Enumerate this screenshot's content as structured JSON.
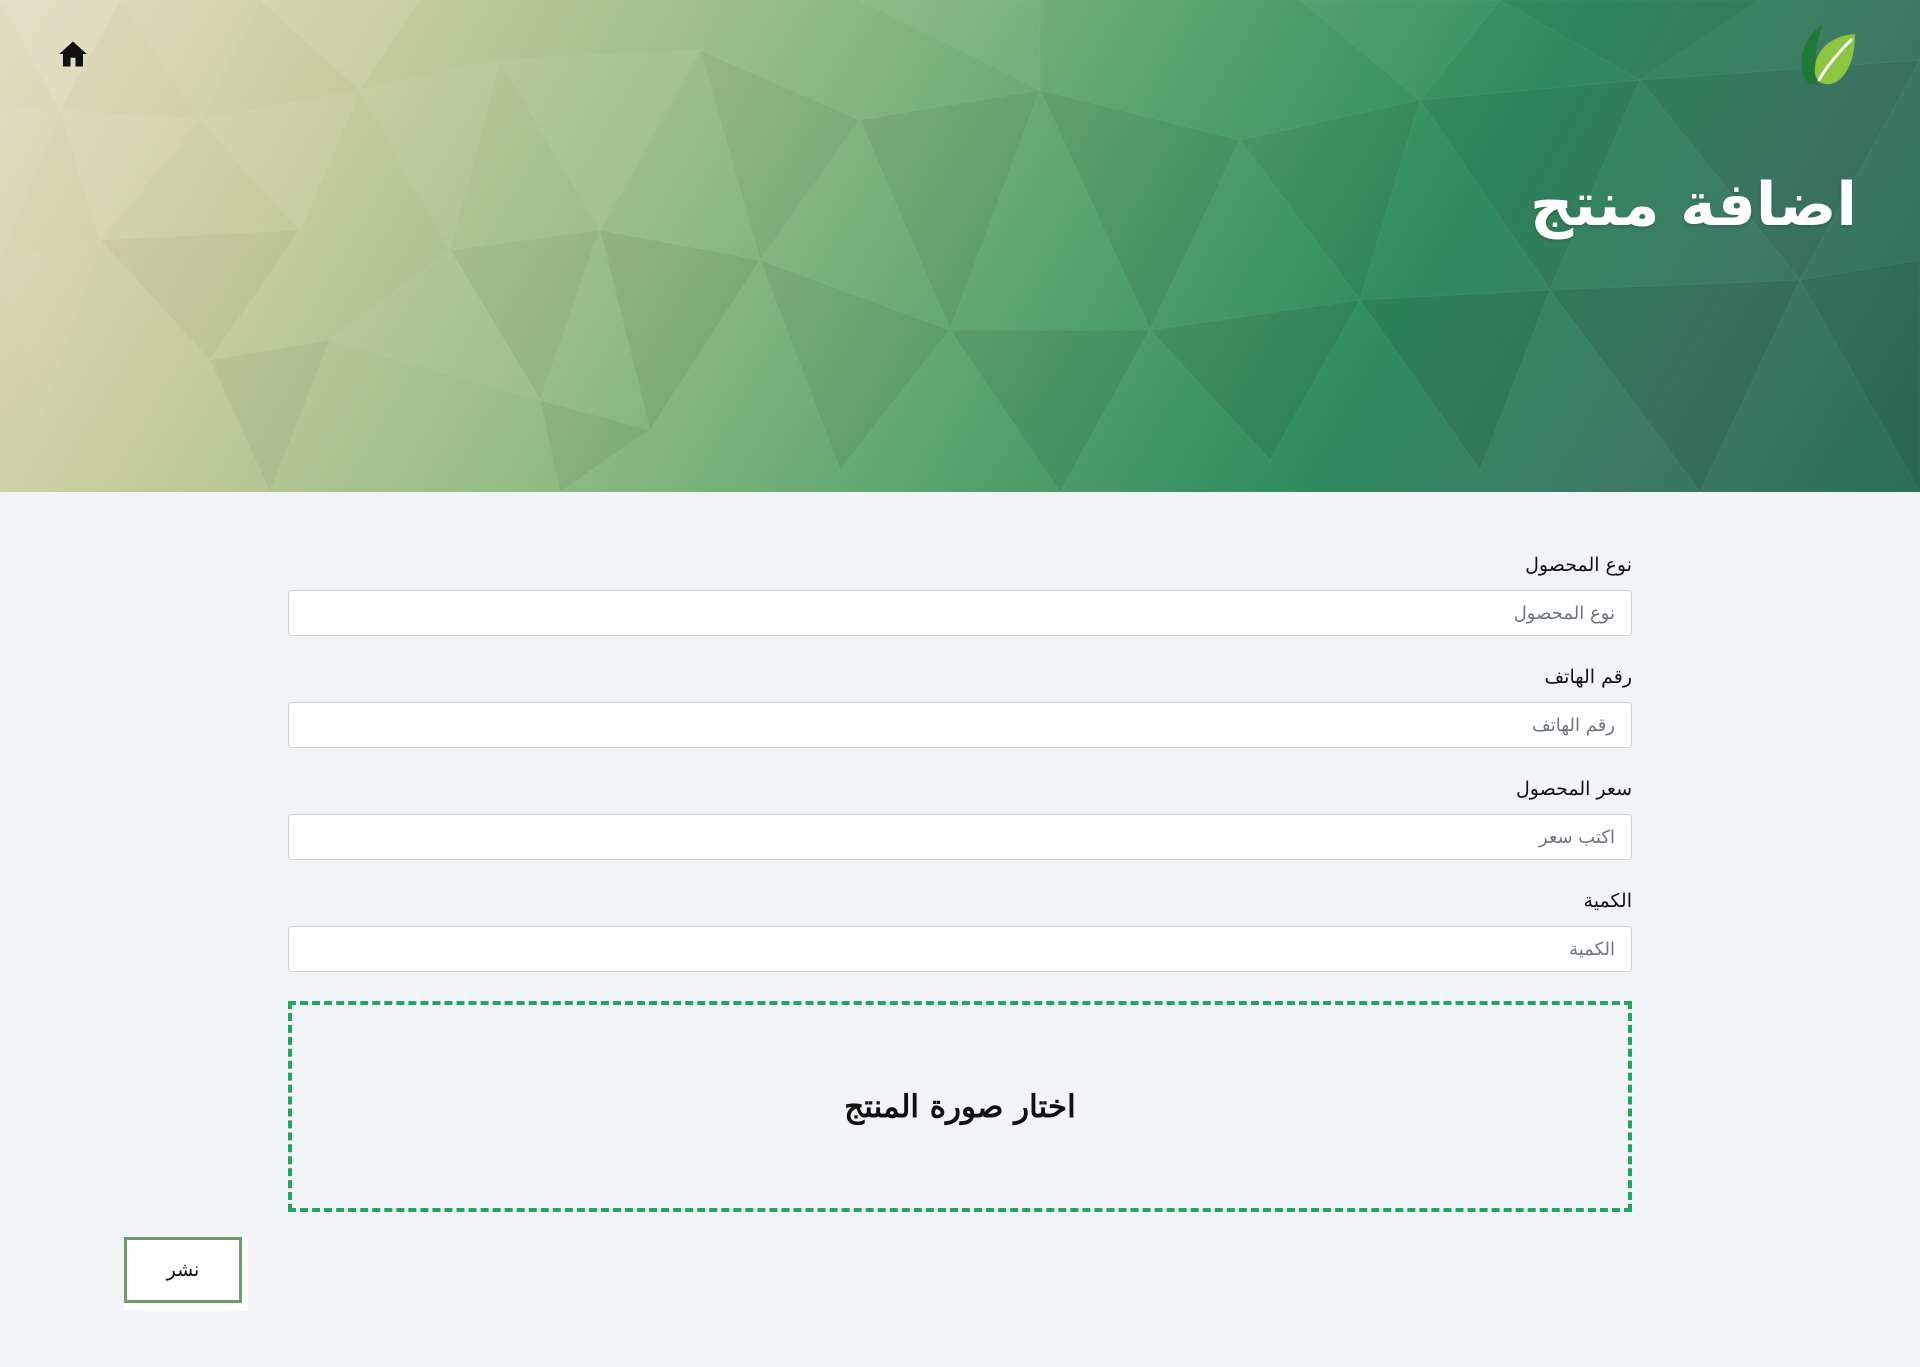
{
  "header": {
    "title": "اضافة منتج",
    "home_icon": "home-icon",
    "logo_icon": "leaf-logo-icon",
    "colors": {
      "hero_light": "#e4dcc2",
      "hero_mid": "#4fa06a",
      "hero_dark": "#2b6e58",
      "logo_dark_leaf": "#1f7a3a",
      "logo_light_leaf": "#8cc63f"
    }
  },
  "form": {
    "fields": [
      {
        "label": "نوع المحصول",
        "placeholder": "نوع المحصول",
        "value": ""
      },
      {
        "label": "رقم الهاتف",
        "placeholder": "رقم الهاتف",
        "value": ""
      },
      {
        "label": "سعر المحصول",
        "placeholder": "اكتب سعر",
        "value": ""
      },
      {
        "label": "الكمية",
        "placeholder": "الكمية",
        "value": ""
      }
    ],
    "image_picker": {
      "label": "اختار صورة المنتج",
      "border_color": "#21a661"
    },
    "submit": {
      "label": "نشر",
      "border_color": "#6f9a6a"
    }
  }
}
